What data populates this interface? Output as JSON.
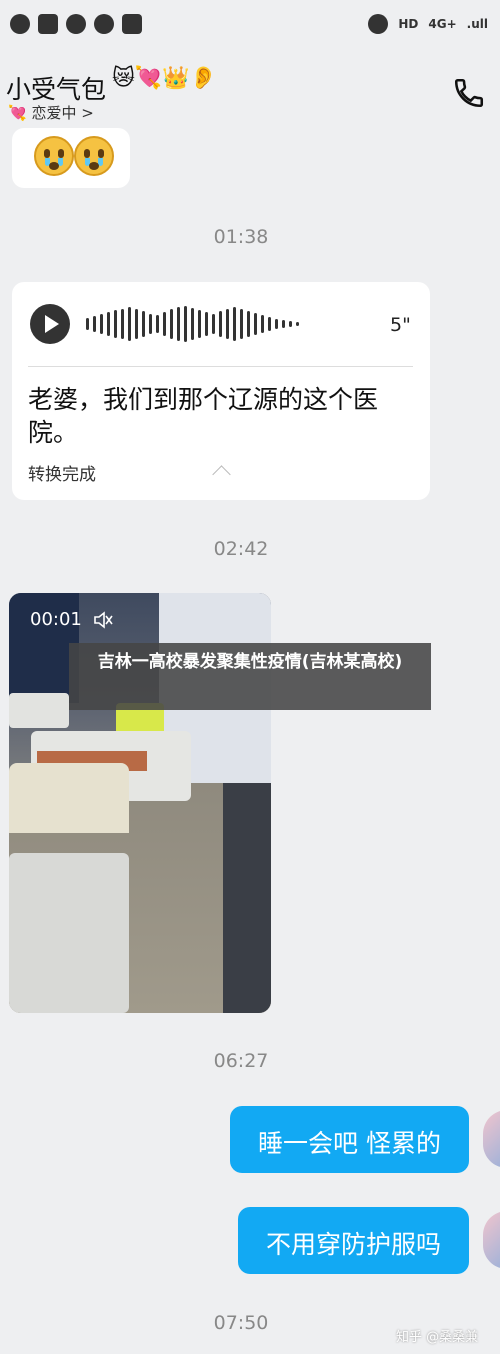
{
  "status_bar": {
    "left_icons": [
      "wechat-icon",
      "iqiyi-icon",
      "play-icon",
      "compass-icon",
      "app-icon"
    ],
    "network": "4G+",
    "hd_label": "HD",
    "wifi_label": ".ull"
  },
  "header": {
    "contact_name": "小受气包",
    "emoji": "😿💘👑👂",
    "relation_label": "恋爱中",
    "relation_icon": "💘",
    "relation_chevron": ">",
    "call_icon": "phone-icon"
  },
  "messages": [
    {
      "type": "emoji",
      "content": "😳😳"
    },
    {
      "type": "timestamp",
      "text": "01:38"
    },
    {
      "type": "voice",
      "duration": "5\"",
      "transcript": "老婆，我们到那个辽源的这个医院。",
      "status": "转换完成"
    },
    {
      "type": "timestamp",
      "text": "02:42"
    },
    {
      "type": "video",
      "time": "00:01"
    },
    {
      "type": "timestamp",
      "text": "06:27"
    },
    {
      "type": "text_out",
      "text": "睡一会吧 怪累的"
    },
    {
      "type": "text_out",
      "text": "不用穿防护服吗"
    },
    {
      "type": "timestamp",
      "text": "07:50"
    }
  ],
  "overlay": {
    "title": "吉林一高校暴发聚集性疫情(吉林某高校)"
  },
  "watermark": "知乎 @桑桑兼"
}
